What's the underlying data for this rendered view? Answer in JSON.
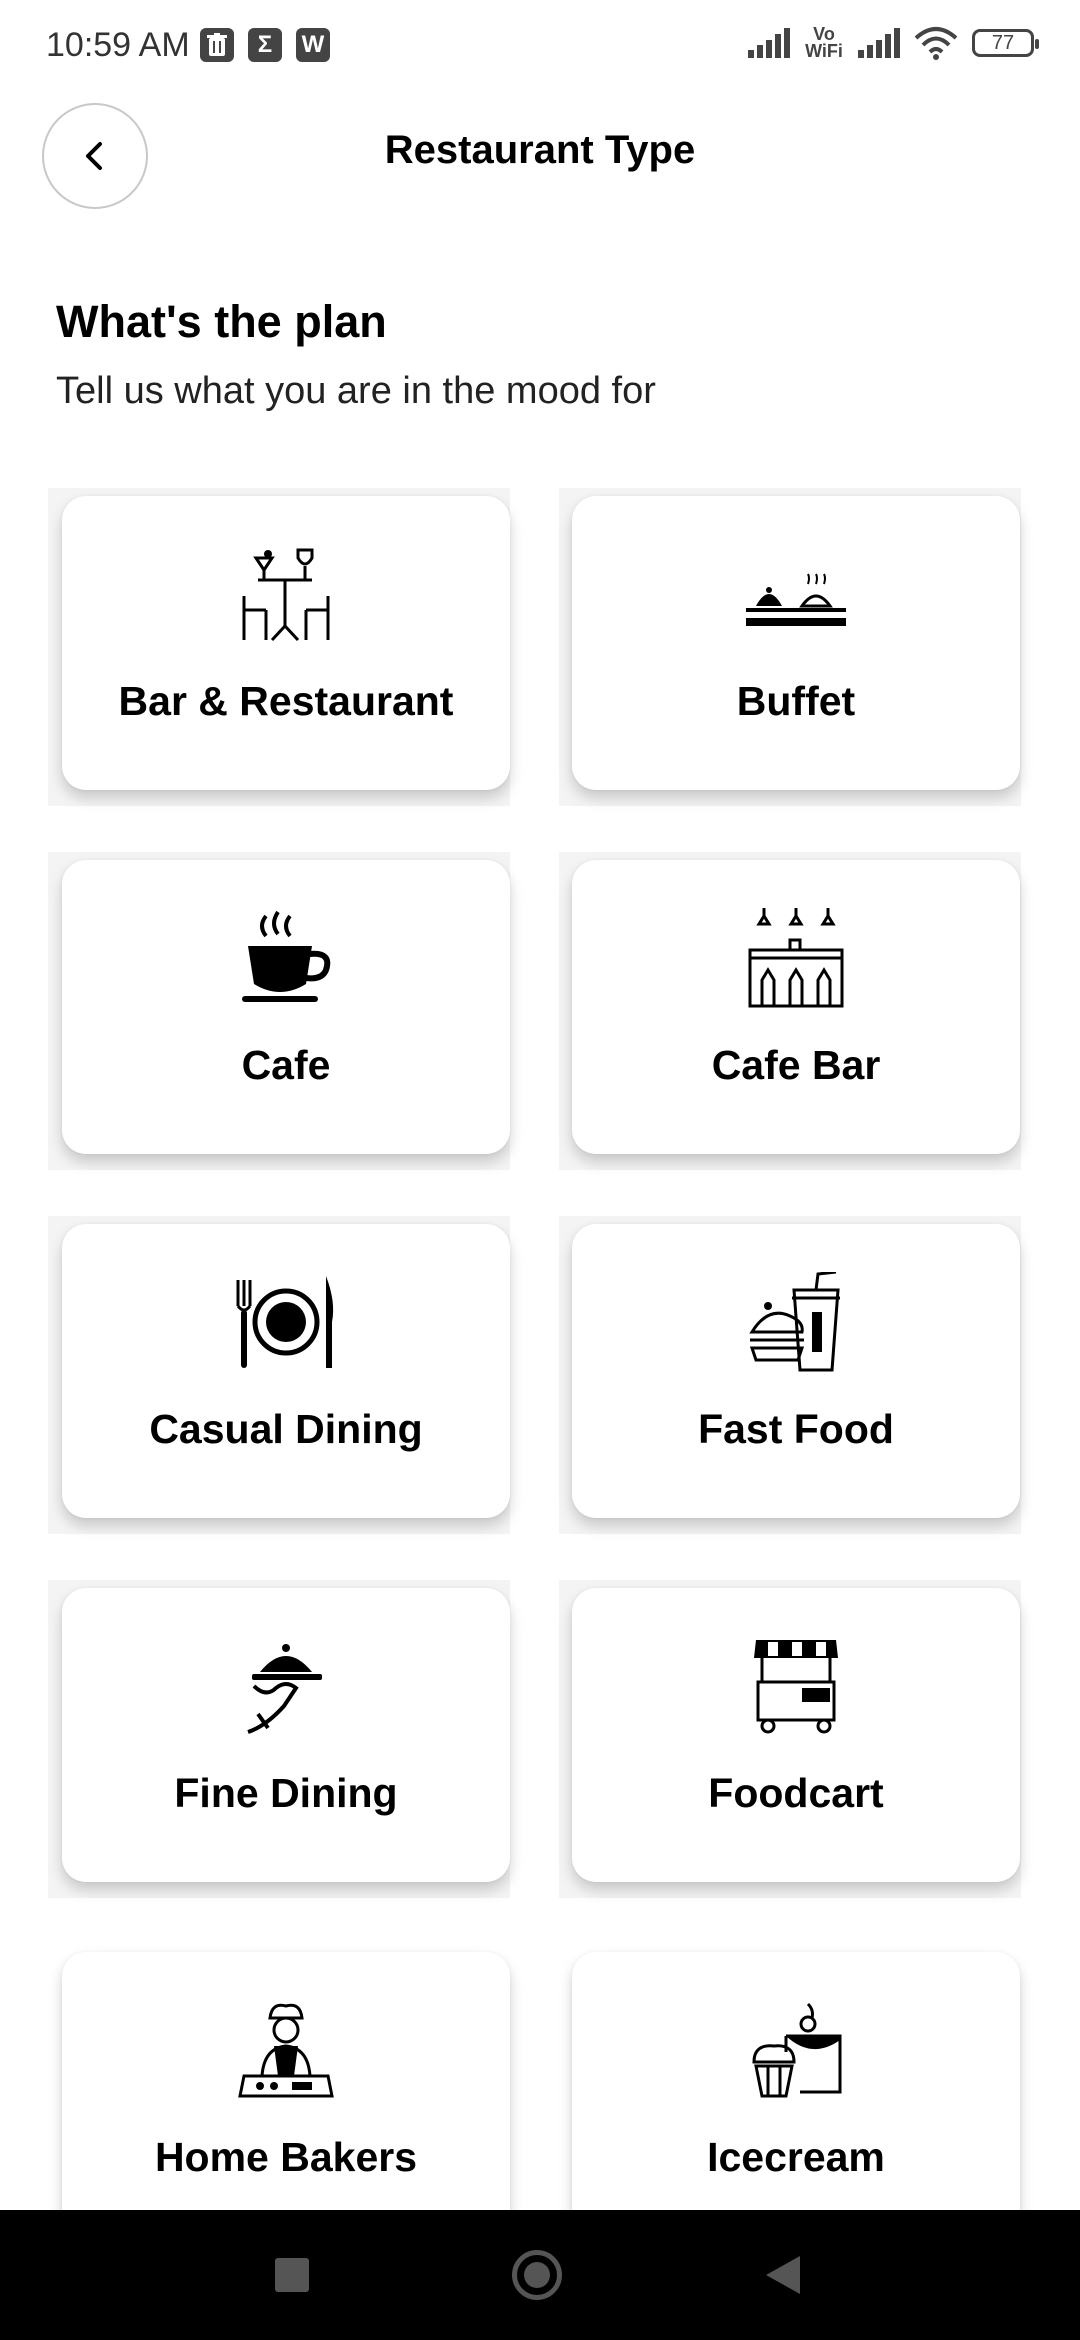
{
  "status_bar": {
    "time": "10:59 AM",
    "left_icons": [
      "trash-icon",
      "sigma-icon",
      "wps-icon"
    ],
    "network_label": "Vo WiFi",
    "battery": "77"
  },
  "header": {
    "title": "Restaurant Type",
    "back_icon": "chevron-left-icon"
  },
  "intro": {
    "heading": "What's the plan",
    "subtitle": "Tell us what you are in the mood for"
  },
  "restaurant_types": [
    {
      "label": "Bar & Restaurant",
      "icon": "bar-table-icon"
    },
    {
      "label": "Buffet",
      "icon": "buffet-icon"
    },
    {
      "label": "Cafe",
      "icon": "coffee-cup-icon"
    },
    {
      "label": "Cafe Bar",
      "icon": "cafe-bar-icon"
    },
    {
      "label": "Casual Dining",
      "icon": "plate-cutlery-icon"
    },
    {
      "label": "Fast Food",
      "icon": "burger-drink-icon"
    },
    {
      "label": "Fine Dining",
      "icon": "cloche-icon"
    },
    {
      "label": "Foodcart",
      "icon": "food-cart-icon"
    },
    {
      "label": "Home Bakers",
      "icon": "baker-icon"
    },
    {
      "label": "Icecream",
      "icon": "dessert-icon"
    }
  ],
  "nav_bar": {
    "icons": [
      "recent-apps-icon",
      "home-icon",
      "back-icon"
    ]
  }
}
